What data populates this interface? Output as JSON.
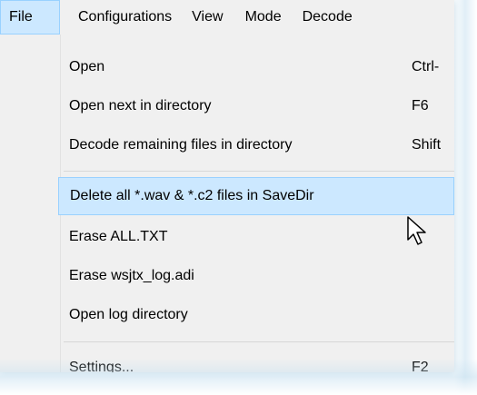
{
  "menubar": {
    "items": [
      {
        "label": "File",
        "active": true
      },
      {
        "label": "Configurations"
      },
      {
        "label": "View"
      },
      {
        "label": "Mode"
      },
      {
        "label": "Decode"
      }
    ]
  },
  "file_menu": {
    "items": [
      {
        "label": "Open",
        "shortcut": "Ctrl-"
      },
      {
        "label": "Open next in directory",
        "shortcut": "F6"
      },
      {
        "label": "Decode remaining files in directory",
        "shortcut": "Shift"
      },
      {
        "label": "Delete all *.wav & *.c2 files in SaveDir",
        "shortcut": "",
        "highlighted": true
      },
      {
        "label": "Erase ALL.TXT",
        "shortcut": ""
      },
      {
        "label": "Erase wsjtx_log.adi",
        "shortcut": ""
      },
      {
        "label": "Open log directory",
        "shortcut": ""
      },
      {
        "label": "Settings...",
        "shortcut": "F2"
      }
    ]
  },
  "colors": {
    "menu_background": "#f0f0f0",
    "highlight_fill": "#cce8ff",
    "highlight_border": "#99d1ff",
    "separator": "#d7d7d7"
  },
  "icons": {
    "cursor": "arrow-cursor-icon"
  }
}
